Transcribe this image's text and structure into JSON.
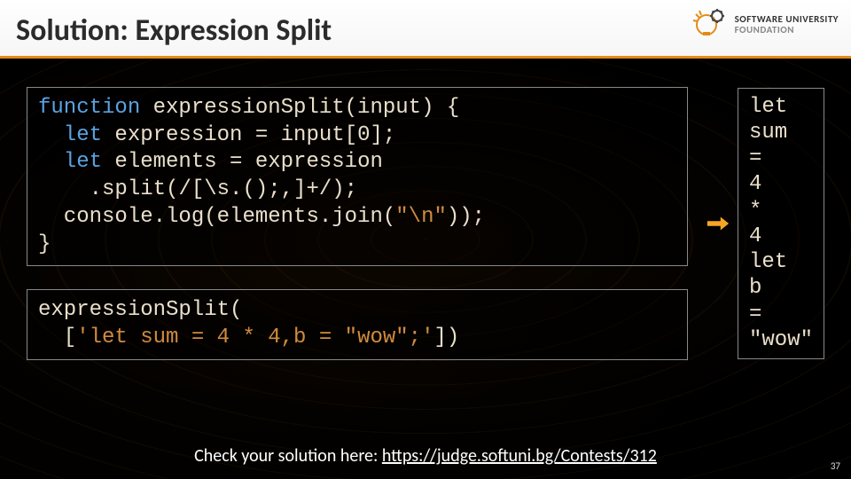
{
  "title": "Solution: Expression Split",
  "logo": {
    "line1": "SOFTWARE",
    "line2": "UNIVERSITY",
    "line3": "FOUNDATION"
  },
  "code": {
    "l1a": "function",
    "l1b": " expressionSplit(input) {",
    "l2a": "  let",
    "l2b": " expression = input[0];",
    "l3a": "  let",
    "l3b": " elements = expression",
    "l4a": "    .",
    "l4b": "split",
    "l4c": "(",
    "l4d": "/[\\s.();,]+/",
    "l4e": ");",
    "l5a": "  console.log(elements.join(",
    "l5b": "\"\\n\"",
    "l5c": "));",
    "l6": "}"
  },
  "call": {
    "l1": "expressionSplit(",
    "l2a": "  [",
    "l2b": "'let sum = 4 * 4,b = \"wow\";'",
    "l2c": "])"
  },
  "output": "let\nsum\n=\n4\n*\n4\nlet\nb\n=\n\"wow\"",
  "footer": {
    "lead": "Check your solution here: ",
    "link": "https://judge.softuni.bg/Contests/312"
  },
  "page": "37"
}
